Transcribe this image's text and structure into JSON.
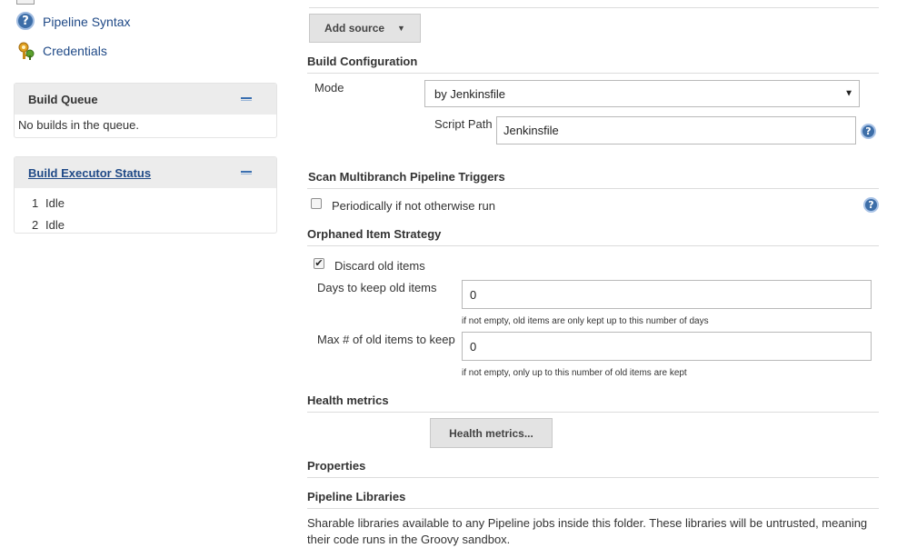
{
  "sidebar": {
    "links": [
      {
        "label": "Pipeline Syntax",
        "icon": "help-icon"
      },
      {
        "label": "Credentials",
        "icon": "credentials-icon"
      }
    ],
    "build_queue": {
      "title": "Build Queue",
      "empty_text": "No builds in the queue."
    },
    "executor_status": {
      "title": "Build Executor Status",
      "executors": [
        {
          "number": "1",
          "state": "Idle"
        },
        {
          "number": "2",
          "state": "Idle"
        }
      ]
    }
  },
  "main": {
    "add_source_label": "Add source",
    "build_configuration": {
      "title": "Build Configuration",
      "mode_label": "Mode",
      "mode_value": "by Jenkinsfile",
      "script_path_label": "Script Path",
      "script_path_value": "Jenkinsfile"
    },
    "scan_triggers": {
      "title": "Scan Multibranch Pipeline Triggers",
      "periodic_label": "Periodically if not otherwise run",
      "periodic_checked": false
    },
    "orphaned": {
      "title": "Orphaned Item Strategy",
      "discard_label": "Discard old items",
      "discard_checked": true,
      "days_label": "Days to keep old items",
      "days_value": "0",
      "days_hint": "if not empty, old items are only kept up to this number of days",
      "max_label": "Max # of old items to keep",
      "max_value": "0",
      "max_hint": "if not empty, only up to this number of old items are kept"
    },
    "health": {
      "title": "Health metrics",
      "button_label": "Health metrics..."
    },
    "properties": {
      "title": "Properties"
    },
    "libraries": {
      "title": "Pipeline Libraries",
      "description": "Sharable libraries available to any Pipeline jobs inside this folder. These libraries will be untrusted, meaning their code runs in the Groovy sandbox."
    }
  },
  "colors": {
    "link": "#204a87",
    "panel_header": "#ececec",
    "button": "#e3e3e3",
    "help_icon": "#3d6ea8"
  }
}
